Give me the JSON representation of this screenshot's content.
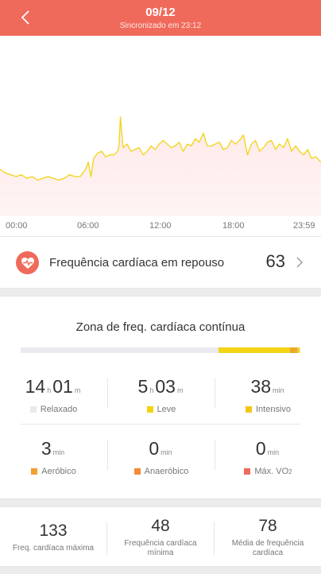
{
  "header": {
    "date": "09/12",
    "sync_text": "Sincronizado em 23:12",
    "bg_color": "#f06a5b"
  },
  "chart_data": {
    "type": "line",
    "x_ticks": [
      "00:00",
      "06:00",
      "12:00",
      "18:00",
      "23:59"
    ],
    "line_color": "#f3d313",
    "fill_color": "#fde7e6",
    "x_range": [
      0,
      24
    ],
    "y_range": [
      40,
      140
    ],
    "series": [
      {
        "x": [
          0,
          0.4,
          0.8,
          1.2,
          1.6,
          2.0,
          2.4,
          2.8,
          3.2,
          3.6,
          4.0,
          4.4,
          4.8,
          5.2,
          5.6,
          6.0,
          6.4,
          6.6,
          6.8,
          7.0,
          7.3,
          7.6,
          7.9,
          8.2,
          8.5,
          8.8,
          8.9,
          9.0,
          9.2,
          9.5,
          9.8,
          10.1,
          10.4,
          10.7,
          11.0,
          11.3,
          11.6,
          11.9,
          12.2,
          12.5,
          12.8,
          13.1,
          13.4,
          13.7,
          14.0,
          14.3,
          14.6,
          14.9,
          15.2,
          15.5,
          15.8,
          16.1,
          16.4,
          16.7,
          17.0,
          17.3,
          17.6,
          17.9,
          18.2,
          18.5,
          18.8,
          19.1,
          19.4,
          19.7,
          20.0,
          20.3,
          20.6,
          20.9,
          21.2,
          21.5,
          21.8,
          22.1,
          22.4,
          22.7,
          23.0,
          23.3,
          23.6,
          24.0
        ],
        "y": [
          66,
          64,
          63,
          62,
          63,
          61,
          62,
          60,
          61,
          62,
          61,
          60,
          61,
          63,
          62,
          62,
          66,
          70,
          62,
          72,
          75,
          76,
          73,
          74,
          74,
          76,
          79,
          95,
          78,
          80,
          76,
          77,
          78,
          74,
          76,
          79,
          77,
          80,
          82,
          80,
          78,
          79,
          81,
          76,
          80,
          79,
          83,
          81,
          86,
          79,
          79,
          80,
          81,
          77,
          78,
          82,
          80,
          82,
          85,
          74,
          80,
          82,
          76,
          78,
          81,
          82,
          77,
          80,
          78,
          83,
          76,
          79,
          76,
          74,
          77,
          72,
          73,
          70
        ]
      }
    ]
  },
  "resting": {
    "label": "Frequência cardíaca em repouso",
    "value": "63"
  },
  "zone": {
    "title": "Zona de freq. cardíaca contínua",
    "bar_segments": [
      {
        "name": "Relaxado",
        "fraction": 0.708,
        "color": "#e9e9ef"
      },
      {
        "name": "Leve",
        "fraction": 0.254,
        "color": "#f3d313"
      },
      {
        "name": "Intensivo",
        "fraction": 0.026,
        "color": "#e8a92a"
      },
      {
        "name": "Aeróbico",
        "fraction": 0.01,
        "color": "#f3d313"
      }
    ],
    "stats": [
      {
        "label": "Relaxado",
        "h": "14",
        "h_unit": "h",
        "m": "01",
        "m_unit": "m",
        "color": "#e9e9ef"
      },
      {
        "label": "Leve",
        "h": "5",
        "h_unit": "h",
        "m": "03",
        "m_unit": "m",
        "color": "#f3d313"
      },
      {
        "label": "Intensivo",
        "value": "38",
        "unit": "min",
        "color": "#f3c613"
      },
      {
        "label": "Aeróbico",
        "value": "3",
        "unit": "min",
        "color": "#f0a031"
      },
      {
        "label": "Anaeróbico",
        "value": "0",
        "unit": "min",
        "color": "#f28b3b"
      },
      {
        "label": "Máx. VO",
        "label_sub": "2",
        "value": "0",
        "unit": "min",
        "color": "#f06a5b"
      }
    ]
  },
  "summary": [
    {
      "value": "133",
      "label": "Freq. cardíaca máxima"
    },
    {
      "value": "48",
      "label": "Frequência cardíaca mínima"
    },
    {
      "value": "78",
      "label": "Média de frequência cardíaca"
    }
  ]
}
